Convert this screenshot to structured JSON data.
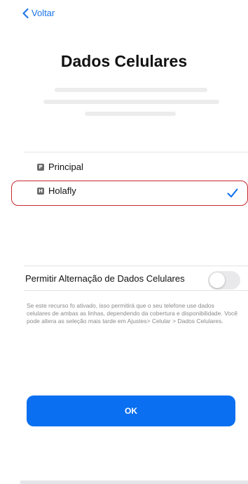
{
  "nav": {
    "back_label": "Voltar",
    "back_icon": "chevron-left-icon"
  },
  "header": {
    "title": "Dados Celulares"
  },
  "lines": {
    "items": [
      {
        "label": "Principal",
        "badge": "P",
        "selected": false
      },
      {
        "label": "Holafly",
        "badge": "H",
        "selected": true
      }
    ]
  },
  "switching": {
    "label": "Permitir Alternação de Dados Celulares",
    "enabled": false,
    "footnote": "Se este recurso fo ativado, isso permitirá que o seu telefone use dados celulares de ambas as linhas, dependendo da cobertura e disponibilidade. Você pode altera as seleção mais tarde em Ajustes> Celular > Dados Celulares."
  },
  "actions": {
    "ok_label": "OK"
  },
  "colors": {
    "accent": "#0a6ff0",
    "highlight_border": "#c62a2f",
    "toggle_off": "#e9e9eb"
  }
}
